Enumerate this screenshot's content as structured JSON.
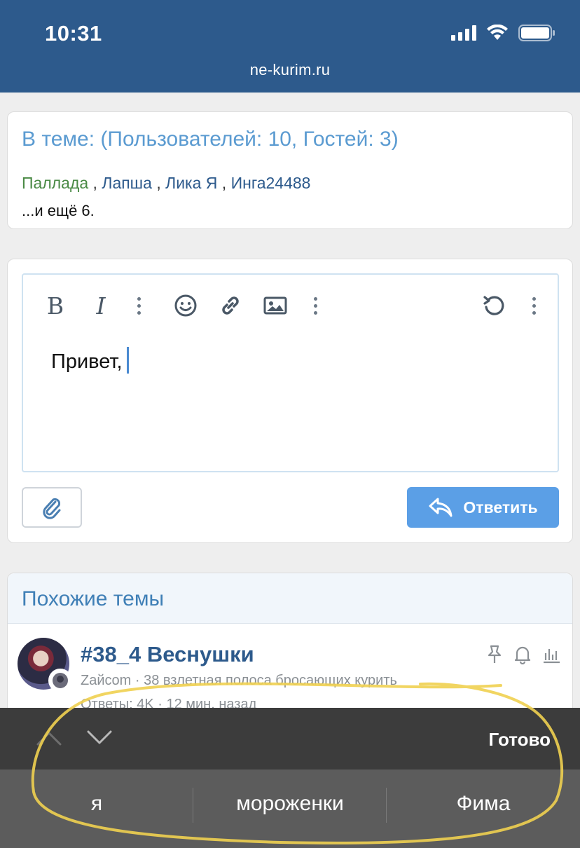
{
  "status_bar": {
    "time": "10:31",
    "url": "ne-kurim.ru"
  },
  "online": {
    "title": "В теме: (Пользователей: 10, Гостей: 3)",
    "users": [
      "Паллада",
      "Лапша",
      "Лика Я",
      "Инга24488"
    ],
    "separator": " , ",
    "more": "...и ещё 6."
  },
  "editor": {
    "text": "Привет,",
    "reply_label": "Ответить"
  },
  "similar": {
    "title": "Похожие темы",
    "topic_title": "#38_4 Веснушки",
    "topic_meta": "Zайcom · 38 взлетная полоса бросающих курить",
    "topic_meta2": "Ответы: 4K · 12 мин. назад"
  },
  "keyboard": {
    "done_label": "Готово",
    "suggestions": [
      "я",
      "мороженки",
      "Фима"
    ]
  },
  "colors": {
    "header_bg": "#2d5a8c",
    "link": "#2d5a8c",
    "title_blue": "#5b9bd1",
    "reply_button": "#5b9fe6",
    "annotation": "#f0d050"
  }
}
